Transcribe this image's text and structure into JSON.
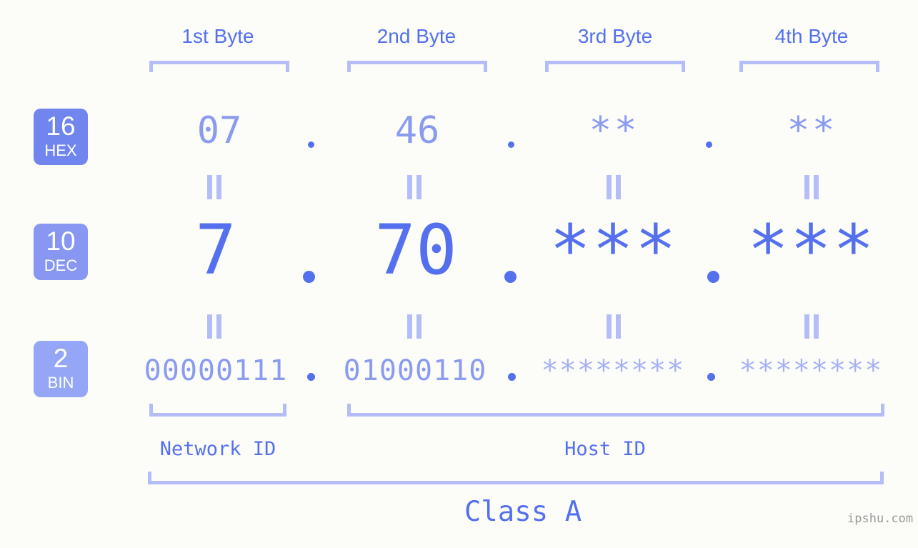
{
  "background_color": "#fcfdf8",
  "accent_color": "#5570ee",
  "accent_light_color": "#8b9bf0",
  "bracket_color": "#b5bdf9",
  "byte_headers": [
    {
      "label": "1st Byte"
    },
    {
      "label": "2nd Byte"
    },
    {
      "label": "3rd Byte"
    },
    {
      "label": "4th Byte"
    }
  ],
  "radix_rows": [
    {
      "base": "16",
      "name": "HEX",
      "badge_color": "#7185ee"
    },
    {
      "base": "10",
      "name": "DEC",
      "badge_color": "#8797f2"
    },
    {
      "base": "2",
      "name": "BIN",
      "badge_color": "#96a6f6"
    }
  ],
  "values": {
    "hex": [
      "07",
      "46",
      "**",
      "**"
    ],
    "dec": [
      "7",
      "70",
      "***",
      "***"
    ],
    "bin": [
      "00000111",
      "01000110",
      "********",
      "********"
    ]
  },
  "separators": {
    "hex": [
      ".",
      ".",
      "."
    ],
    "dec": [
      ".",
      ".",
      "."
    ],
    "bin": [
      ".",
      ".",
      "."
    ]
  },
  "equality_symbol": "=",
  "id_sections": [
    {
      "label": "Network ID"
    },
    {
      "label": "Host ID"
    }
  ],
  "class_label": "Class A",
  "watermark": "ipshu.com"
}
